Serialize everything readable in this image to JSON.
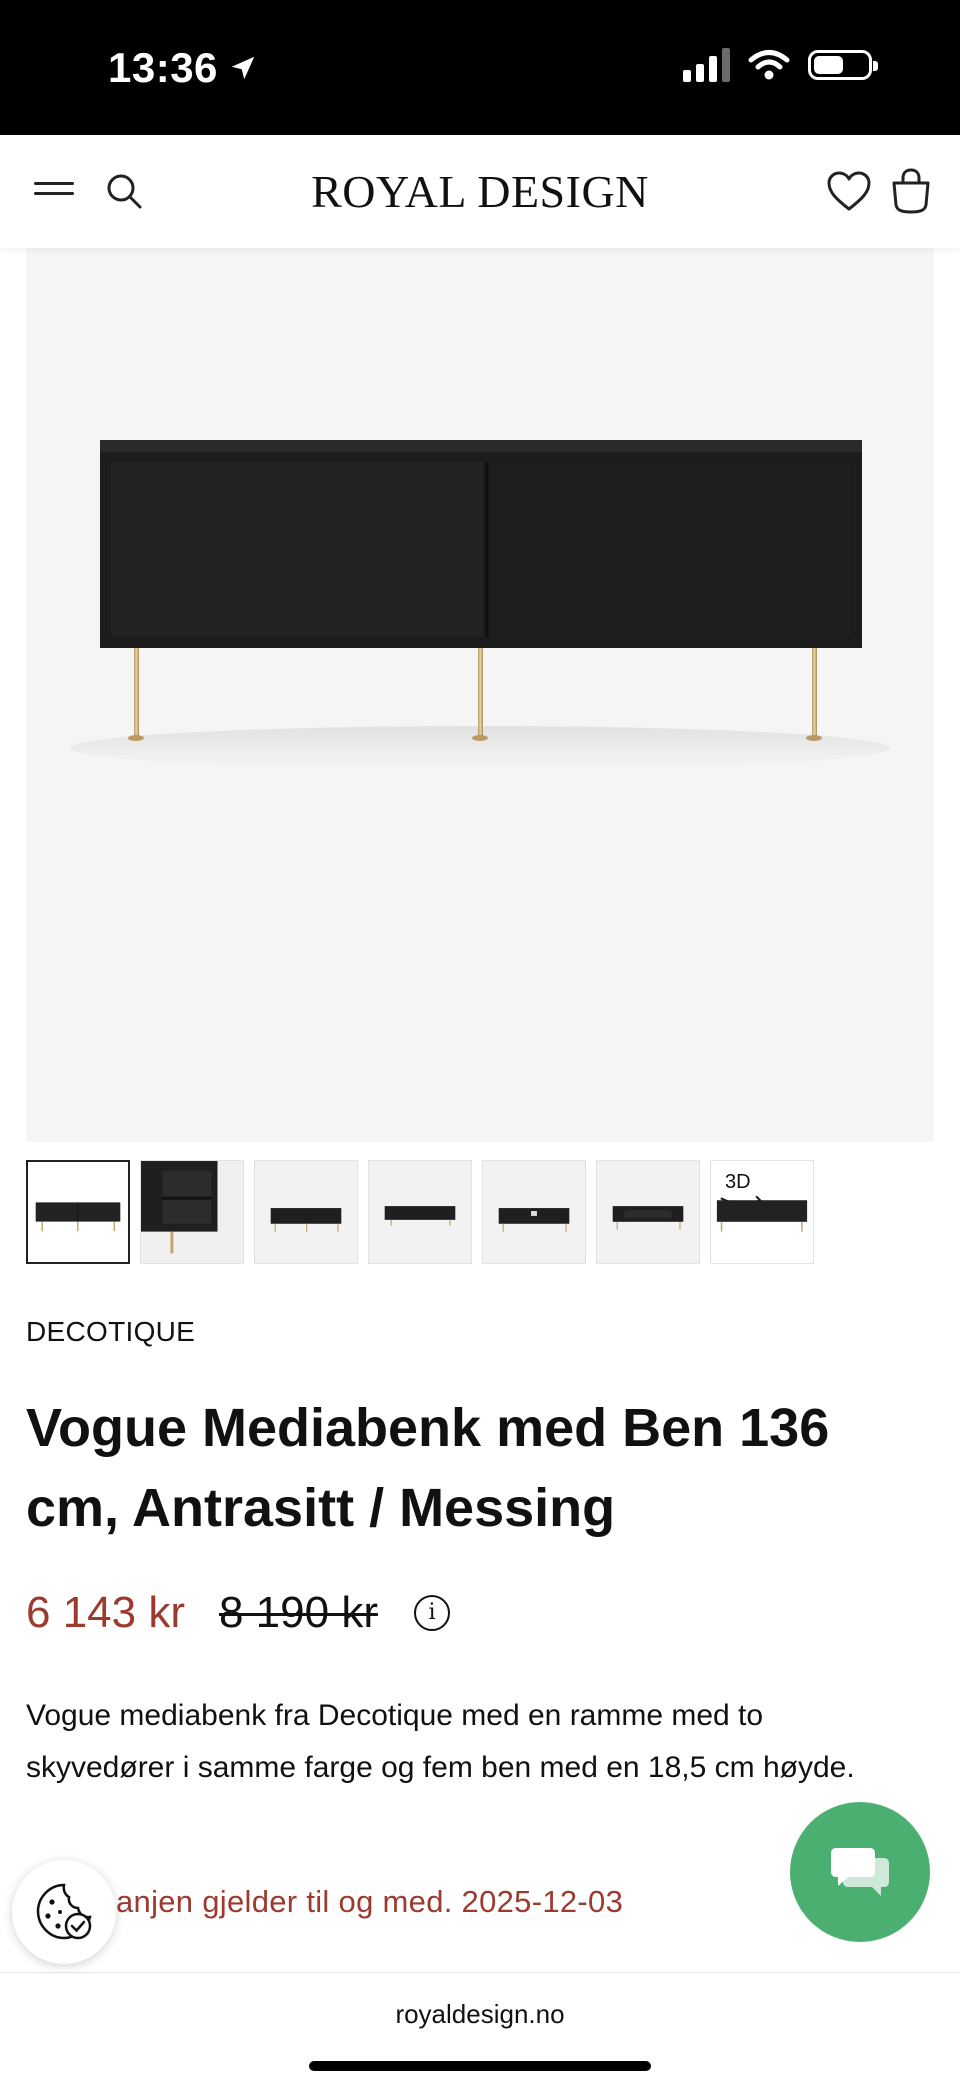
{
  "status_bar": {
    "time": "13:36"
  },
  "header": {
    "logo": "ROYAL DESIGN"
  },
  "thumbnails": {
    "count": 7,
    "active_index": 0,
    "last_label": "3D"
  },
  "product": {
    "brand": "DECOTIQUE",
    "title": "Vogue Mediabenk med Ben 136 cm, Antrasitt / Messing",
    "price_current": "6 143 kr",
    "price_original": "8 190 kr",
    "description": "Vogue mediabenk fra Decotique med en ramme med to skyvedører i samme farge og fem ben med en 18,5 cm høyde.",
    "campaign_text": "anjen gjelder til og med. 2025-12-03"
  },
  "browser": {
    "url": "royaldesign.no"
  },
  "colors": {
    "sale_price": "#9b3a2e",
    "chat_button": "#4caf72",
    "status_bar": "#000000"
  },
  "icons": [
    "location-arrow-icon",
    "signal-icon",
    "wifi-icon",
    "battery-icon",
    "menu-icon",
    "search-icon",
    "heart-icon",
    "shopping-bag-icon",
    "info-icon",
    "cookie-icon",
    "chat-icon",
    "3d-rotate-icon"
  ]
}
